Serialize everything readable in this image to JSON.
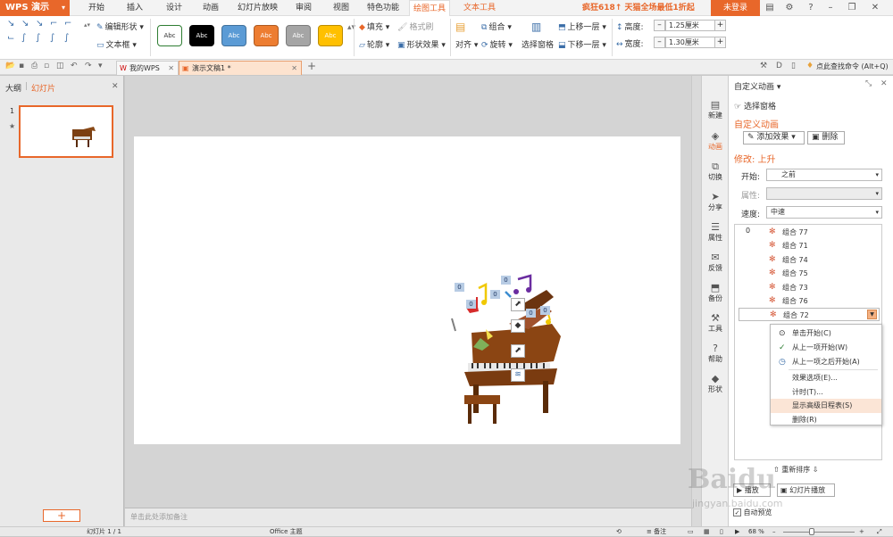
{
  "app": {
    "name": "WPS 演示"
  },
  "menu": {
    "tabs": [
      "开始",
      "插入",
      "设计",
      "动画",
      "幻灯片放映",
      "审阅",
      "视图",
      "特色功能",
      "绘图工具",
      "文本工具"
    ],
    "active": "绘图工具",
    "promo": "疯狂618↑ 天猫全场最低1折起",
    "login": "未登录"
  },
  "ribbon": {
    "edit_shape": "编辑形状",
    "textbox": "文本框",
    "styles": [
      {
        "label": "Abc",
        "bg": "#ffffff",
        "fg": "#333333",
        "border": "#2e7d32"
      },
      {
        "label": "Abc",
        "bg": "#000000",
        "fg": "#ffffff",
        "border": "#000000"
      },
      {
        "label": "Abc",
        "bg": "#5b9bd5",
        "fg": "#ffffff",
        "border": "#41719c"
      },
      {
        "label": "Abc",
        "bg": "#ed7d31",
        "fg": "#ffffff",
        "border": "#ae5a21"
      },
      {
        "label": "Abc",
        "bg": "#a5a5a5",
        "fg": "#ffffff",
        "border": "#7b7b7b"
      },
      {
        "label": "Abc",
        "bg": "#ffc000",
        "fg": "#ffffff",
        "border": "#bc8c00"
      }
    ],
    "fill": "填充",
    "format_painter": "格式刷",
    "outline": "轮廓",
    "shape_effects": "形状效果",
    "align": "对齐",
    "group": "组合",
    "rotate": "旋转",
    "select_pane": "选择窗格",
    "bring_forward": "上移一层",
    "send_backward": "下移一层",
    "height_label": "高度:",
    "height_value": "1.25厘米",
    "width_label": "宽度:",
    "width_value": "1.30厘米"
  },
  "quickbar": {
    "tabs": [
      {
        "label": "我的WPS"
      },
      {
        "label": "演示文稿1 *"
      }
    ],
    "search": "点此查找命令 (Alt+Q)"
  },
  "left_panel": {
    "tab_outline": "大纲",
    "tab_slides": "幻灯片",
    "slide_number": "1"
  },
  "notes_placeholder": "单击此处添加备注",
  "sidebar": {
    "items": [
      {
        "label": "新建",
        "icon": "new-icon"
      },
      {
        "label": "动画",
        "icon": "animation-icon"
      },
      {
        "label": "切换",
        "icon": "transition-icon"
      },
      {
        "label": "分享",
        "icon": "share-icon"
      },
      {
        "label": "属性",
        "icon": "property-icon"
      },
      {
        "label": "反馈",
        "icon": "feedback-icon"
      },
      {
        "label": "备份",
        "icon": "backup-icon"
      },
      {
        "label": "工具",
        "icon": "tools-icon"
      },
      {
        "label": "帮助",
        "icon": "help-icon"
      },
      {
        "label": "形状",
        "icon": "shape-icon"
      }
    ]
  },
  "taskpane": {
    "title": "自定义动画",
    "select_pane": "选择窗格",
    "section": "自定义动画",
    "add_effect": "添加效果",
    "delete": "删除",
    "modify": "修改: 上升",
    "start_label": "开始:",
    "start_value": "之前",
    "property_label": "属性:",
    "speed_label": "速度:",
    "speed_value": "中速",
    "list_index": "0",
    "items": [
      "组合 77",
      "组合 71",
      "组合 74",
      "组合 75",
      "组合 73",
      "组合 76",
      "组合 72"
    ],
    "reorder": "重新排序",
    "play": "播放",
    "slideshow": "幻灯片播放",
    "autopreview": "自动预览"
  },
  "context_menu": {
    "items": [
      "单击开始(C)",
      "从上一项开始(W)",
      "从上一项之后开始(A)",
      "效果选项(E)...",
      "计时(T)...",
      "显示高级日程表(S)",
      "删除(R)"
    ],
    "hover": "显示高级日程表(S)"
  },
  "status": {
    "slide": "幻灯片 1 / 1",
    "theme": "Office 主题",
    "notes": "备注",
    "zoom": "68 %",
    "zoom_level": 0.4
  },
  "slide_badges": [
    "0",
    "0",
    "0",
    "0",
    "0",
    "0"
  ],
  "watermark": {
    "brand": "Baidu",
    "url": "jingyan.baidu.com"
  }
}
